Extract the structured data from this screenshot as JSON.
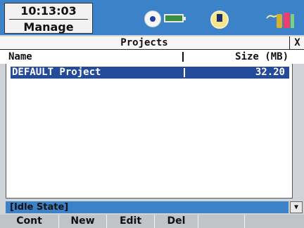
{
  "status_bar": {
    "time": "10:13:03",
    "screen_name": "Manage",
    "icons": [
      "disc-icon",
      "battery-icon",
      "satellite-icon",
      "power-icon"
    ]
  },
  "window": {
    "title": "Projects",
    "close_label": "X"
  },
  "table": {
    "columns": [
      "Name",
      "Size (MB)"
    ],
    "rows": [
      {
        "name": "DEFAULT Project",
        "size": "32.20",
        "selected": true
      }
    ]
  },
  "status_line": {
    "text": "[Idle State]",
    "dropdown_glyph": "▼"
  },
  "softkeys": [
    "Cont",
    "New",
    "Edit",
    "Del",
    "",
    ""
  ],
  "colors": {
    "accent": "#3b82c9",
    "selection": "#244a9a",
    "softkey_bg": "#bfc4cb"
  }
}
